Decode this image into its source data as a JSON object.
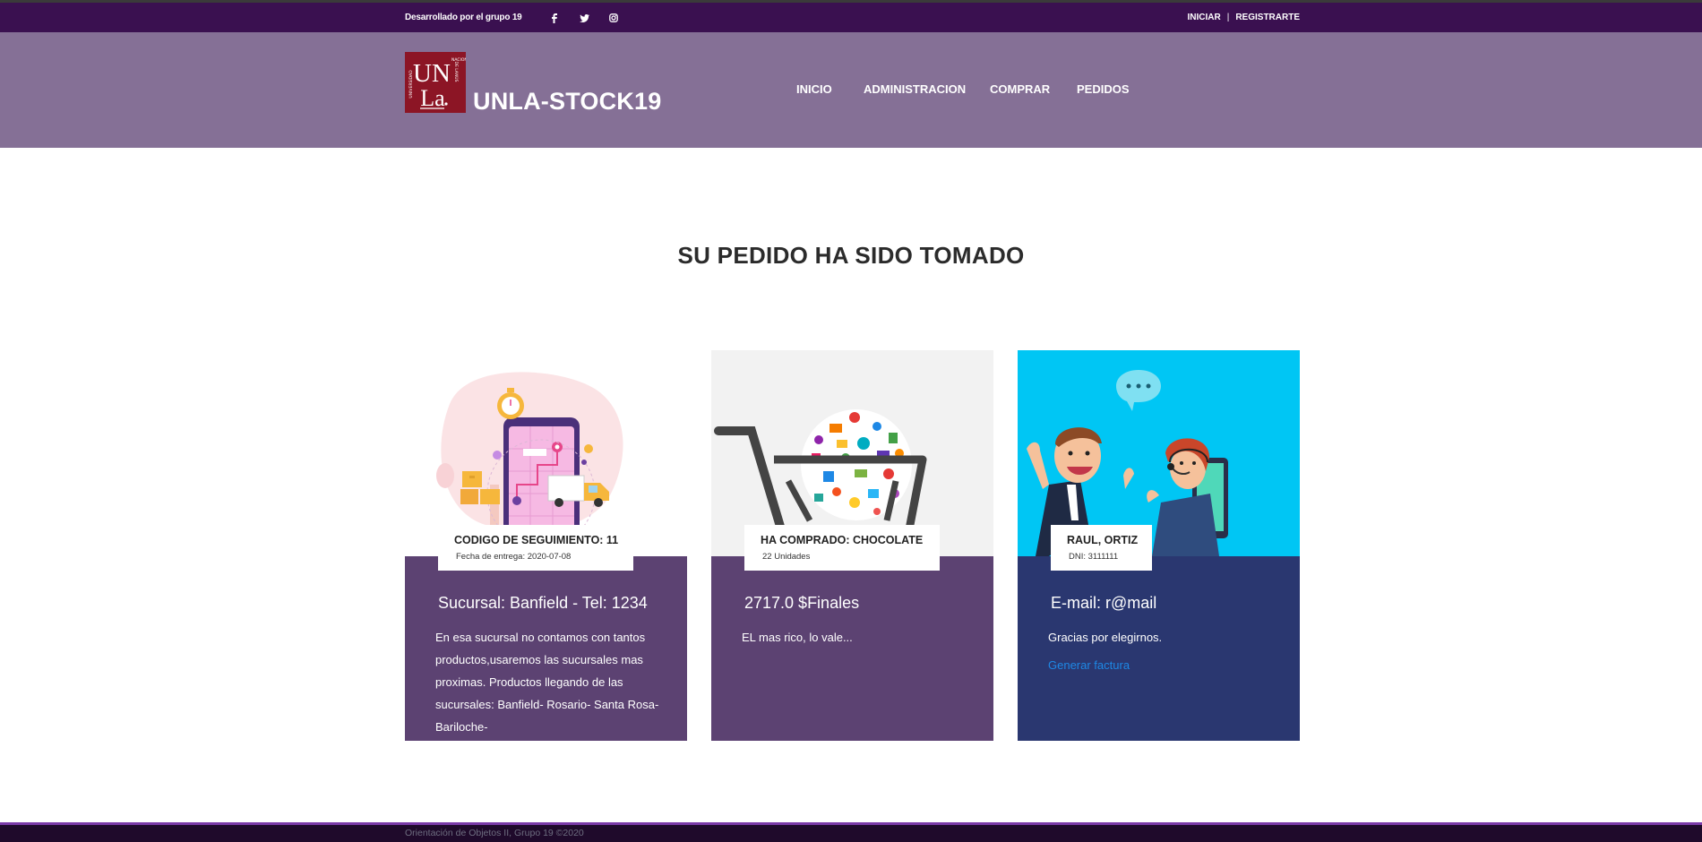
{
  "topbar": {
    "credit": "Desarrollado por el grupo 19",
    "social_icons": [
      "facebook-icon",
      "twitter-icon",
      "instagram-icon"
    ],
    "login_label": "INICIAR",
    "separator": "|",
    "register_label": "REGISTRARTE"
  },
  "header": {
    "logo_text": "UNLa",
    "brand": "UNLA-STOCK19",
    "nav": [
      "INICIO",
      "ADMINISTRACION",
      "COMPRAR",
      "PEDIDOS"
    ]
  },
  "page": {
    "title": "SU PEDIDO HA SIDO TOMADO"
  },
  "cards": [
    {
      "label_title": "CODIGO DE SEGUIMIENTO: 11",
      "label_sub": "Fecha de entrega: 2020-07-08",
      "heading": "Sucursal: Banfield - Tel: 1234",
      "text": "En esa sucursal no contamos con tantos productos,usaremos las sucursales mas proximas. Productos llegando de las sucursales: Banfield- Rosario- Santa Rosa- Bariloche-",
      "image": "delivery-tracking-illustration"
    },
    {
      "label_title": "HA COMPRADO: CHOCOLATE",
      "label_sub": "22 Unidades",
      "heading": "2717.0 $Finales",
      "text": "EL mas rico, lo vale...",
      "image": "shopping-cart-illustration"
    },
    {
      "label_title": "RAUL, ORTIZ",
      "label_sub": "DNI: 3111111",
      "heading": "E-mail: r@mail",
      "text": "Gracias por elegirnos.",
      "link": "Generar factura",
      "image": "customer-support-illustration"
    }
  ],
  "footer": {
    "text": "Orientación de Objetos II, Grupo 19 ©2020"
  },
  "colors": {
    "topbar": "#3a1050",
    "header": "#857096",
    "card_purple": "#5c4272",
    "card_navy": "#2a3770",
    "link": "#1e88e5"
  }
}
